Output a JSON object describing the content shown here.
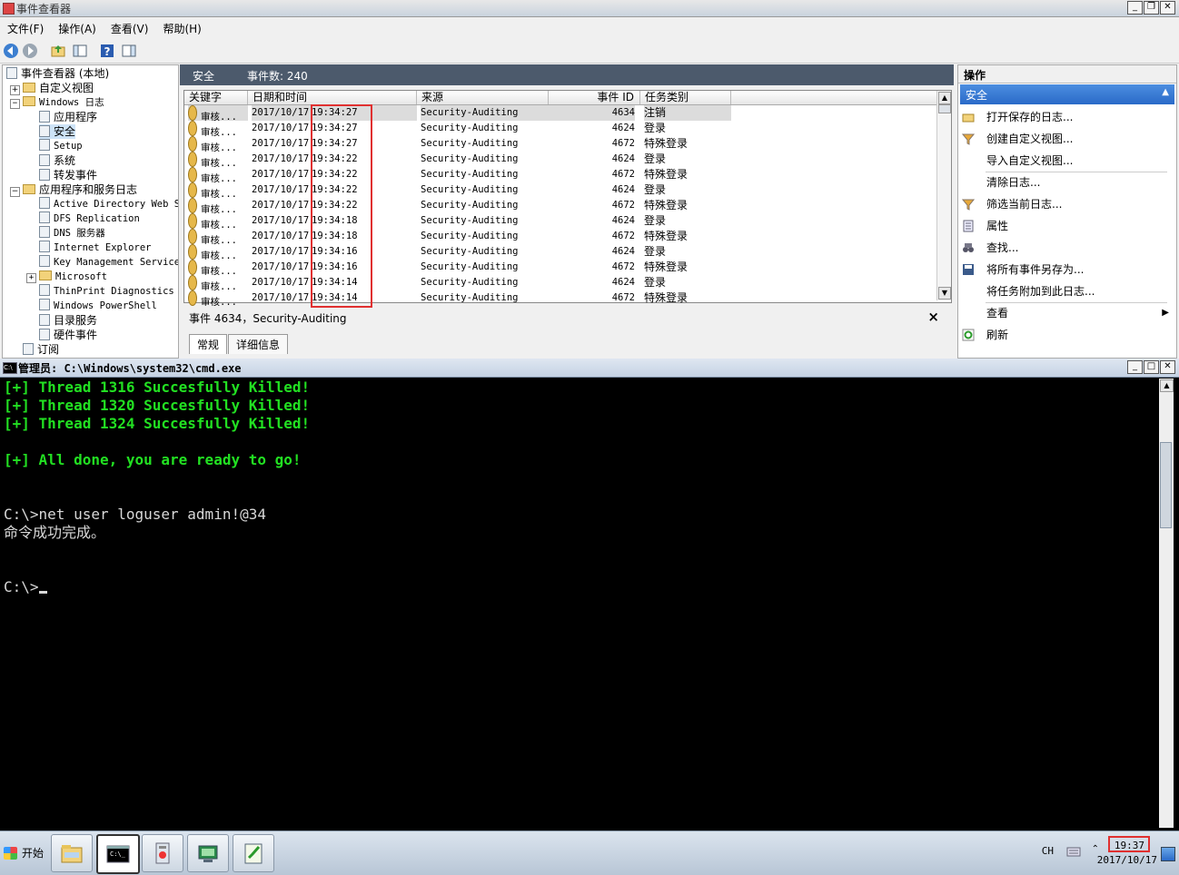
{
  "event_viewer": {
    "title": "事件查看器",
    "menu": [
      "文件(F)",
      "操作(A)",
      "查看(V)",
      "帮助(H)"
    ],
    "tree": [
      {
        "label": "事件查看器 (本地)",
        "level": 0,
        "kind": "root"
      },
      {
        "label": "自定义视图",
        "level": 1,
        "kind": "folder",
        "expander": "+"
      },
      {
        "label": "Windows 日志",
        "level": 1,
        "kind": "folder",
        "expander": "−",
        "mono": true
      },
      {
        "label": "应用程序",
        "level": 2,
        "kind": "log"
      },
      {
        "label": "安全",
        "level": 2,
        "kind": "log",
        "selected": true
      },
      {
        "label": "Setup",
        "level": 2,
        "kind": "log",
        "mono": true
      },
      {
        "label": "系统",
        "level": 2,
        "kind": "log"
      },
      {
        "label": "转发事件",
        "level": 2,
        "kind": "log"
      },
      {
        "label": "应用程序和服务日志",
        "level": 1,
        "kind": "folder",
        "expander": "−"
      },
      {
        "label": "Active Directory Web S",
        "level": 2,
        "kind": "log",
        "mono": true
      },
      {
        "label": "DFS Replication",
        "level": 2,
        "kind": "log",
        "mono": true
      },
      {
        "label": "DNS 服务器",
        "level": 2,
        "kind": "log",
        "mono": true
      },
      {
        "label": "Internet Explorer",
        "level": 2,
        "kind": "log",
        "mono": true
      },
      {
        "label": "Key Management Service",
        "level": 2,
        "kind": "log",
        "mono": true
      },
      {
        "label": "Microsoft",
        "level": 2,
        "kind": "folder",
        "expander": "+",
        "mono": true
      },
      {
        "label": "ThinPrint Diagnostics",
        "level": 2,
        "kind": "log",
        "mono": true
      },
      {
        "label": "Windows PowerShell",
        "level": 2,
        "kind": "log",
        "mono": true
      },
      {
        "label": "目录服务",
        "level": 2,
        "kind": "log"
      },
      {
        "label": "硬件事件",
        "level": 2,
        "kind": "log"
      },
      {
        "label": "订阅",
        "level": 1,
        "kind": "log"
      }
    ],
    "pane": {
      "title": "安全",
      "count_label": "事件数: 240"
    },
    "columns": [
      "关键字",
      "日期和时间",
      "来源",
      "事件 ID",
      "任务类别"
    ],
    "events": [
      {
        "keyword": "审核...",
        "date": "2017/10/17",
        "time": "19:34:27",
        "source": "Security-Auditing",
        "id": "4634",
        "category": "注销",
        "selected": true
      },
      {
        "keyword": "审核...",
        "date": "2017/10/17",
        "time": "19:34:27",
        "source": "Security-Auditing",
        "id": "4624",
        "category": "登录"
      },
      {
        "keyword": "审核...",
        "date": "2017/10/17",
        "time": "19:34:27",
        "source": "Security-Auditing",
        "id": "4672",
        "category": "特殊登录"
      },
      {
        "keyword": "审核...",
        "date": "2017/10/17",
        "time": "19:34:22",
        "source": "Security-Auditing",
        "id": "4624",
        "category": "登录"
      },
      {
        "keyword": "审核...",
        "date": "2017/10/17",
        "time": "19:34:22",
        "source": "Security-Auditing",
        "id": "4672",
        "category": "特殊登录"
      },
      {
        "keyword": "审核...",
        "date": "2017/10/17",
        "time": "19:34:22",
        "source": "Security-Auditing",
        "id": "4624",
        "category": "登录"
      },
      {
        "keyword": "审核...",
        "date": "2017/10/17",
        "time": "19:34:22",
        "source": "Security-Auditing",
        "id": "4672",
        "category": "特殊登录"
      },
      {
        "keyword": "审核...",
        "date": "2017/10/17",
        "time": "19:34:18",
        "source": "Security-Auditing",
        "id": "4624",
        "category": "登录"
      },
      {
        "keyword": "审核...",
        "date": "2017/10/17",
        "time": "19:34:18",
        "source": "Security-Auditing",
        "id": "4672",
        "category": "特殊登录"
      },
      {
        "keyword": "审核...",
        "date": "2017/10/17",
        "time": "19:34:16",
        "source": "Security-Auditing",
        "id": "4624",
        "category": "登录"
      },
      {
        "keyword": "审核...",
        "date": "2017/10/17",
        "time": "19:34:16",
        "source": "Security-Auditing",
        "id": "4672",
        "category": "特殊登录"
      },
      {
        "keyword": "审核...",
        "date": "2017/10/17",
        "time": "19:34:14",
        "source": "Security-Auditing",
        "id": "4624",
        "category": "登录"
      },
      {
        "keyword": "审核...",
        "date": "2017/10/17",
        "time": "19:34:14",
        "source": "Security-Auditing",
        "id": "4672",
        "category": "特殊登录"
      }
    ],
    "detail": {
      "title": "事件 4634，Security-Auditing",
      "close": "×",
      "tabs": [
        "常规",
        "详细信息"
      ]
    },
    "actions": {
      "header": "操作",
      "section": "安全",
      "items": [
        {
          "label": "打开保存的日志...",
          "icon": "folder-open-icon"
        },
        {
          "label": "创建自定义视图...",
          "icon": "filter-icon"
        },
        {
          "label": "导入自定义视图...",
          "icon": ""
        },
        {
          "label": "清除日志...",
          "icon": ""
        },
        {
          "label": "筛选当前日志...",
          "icon": "filter-icon"
        },
        {
          "label": "属性",
          "icon": "properties-icon"
        },
        {
          "label": "查找...",
          "icon": "binoculars-icon"
        },
        {
          "label": "将所有事件另存为...",
          "icon": "save-icon"
        },
        {
          "label": "将任务附加到此日志...",
          "icon": ""
        },
        {
          "label": "查看",
          "icon": "",
          "submenu": true
        },
        {
          "label": "刷新",
          "icon": "refresh-icon"
        }
      ]
    }
  },
  "cmd": {
    "title": "管理员: C:\\Windows\\system32\\cmd.exe",
    "lines": [
      {
        "text": "[+] Thread 1316 Succesfully Killed!",
        "color": "green"
      },
      {
        "text": "[+] Thread 1320 Succesfully Killed!",
        "color": "green"
      },
      {
        "text": "[+] Thread 1324 Succesfully Killed!",
        "color": "green"
      },
      {
        "text": "",
        "color": "white"
      },
      {
        "text": "[+] All done, you are ready to go!",
        "color": "green"
      },
      {
        "text": "",
        "color": "white"
      },
      {
        "text": "",
        "color": "white"
      },
      {
        "text": "C:\\>net user loguser admin!@34",
        "color": "white"
      },
      {
        "text": "命令成功完成。",
        "color": "white"
      },
      {
        "text": "",
        "color": "white"
      },
      {
        "text": "",
        "color": "white"
      },
      {
        "text": "C:\\>",
        "color": "white",
        "cursor": true
      }
    ]
  },
  "taskbar": {
    "start": "开始",
    "items": [
      "explorer-icon",
      "cmd-icon",
      "event-viewer-icon",
      "server-manager-icon",
      "notepad-icon"
    ],
    "tray": {
      "lang": "CH",
      "time": "19:37",
      "date": "2017/10/17"
    }
  }
}
